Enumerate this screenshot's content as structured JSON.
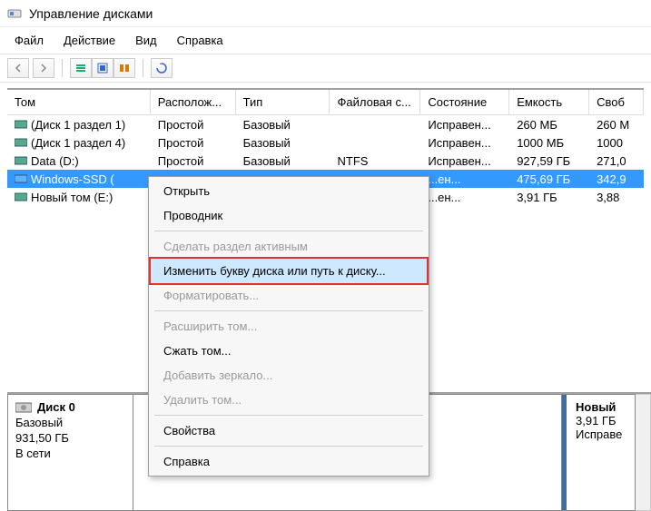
{
  "window": {
    "title": "Управление дисками"
  },
  "menu": {
    "file": "Файл",
    "action": "Действие",
    "view": "Вид",
    "help": "Справка"
  },
  "columns": {
    "volume": "Том",
    "layout": "Располож...",
    "type": "Тип",
    "fs": "Файловая с...",
    "status": "Состояние",
    "capacity": "Емкость",
    "free": "Своб"
  },
  "rows": [
    {
      "volume": "(Диск 1 раздел 1)",
      "layout": "Простой",
      "type": "Базовый",
      "fs": "",
      "status": "Исправен...",
      "capacity": "260 МБ",
      "free": "260 М",
      "selected": false
    },
    {
      "volume": "(Диск 1 раздел 4)",
      "layout": "Простой",
      "type": "Базовый",
      "fs": "",
      "status": "Исправен...",
      "capacity": "1000 МБ",
      "free": "1000",
      "selected": false
    },
    {
      "volume": "Data (D:)",
      "layout": "Простой",
      "type": "Базовый",
      "fs": "NTFS",
      "status": "Исправен...",
      "capacity": "927,59 ГБ",
      "free": "271,0",
      "selected": false
    },
    {
      "volume": "Windows-SSD (",
      "layout": "",
      "type": "",
      "fs": "",
      "status": "...ен...",
      "capacity": "475,69 ГБ",
      "free": "342,9",
      "selected": true
    },
    {
      "volume": "Новый том (E:)",
      "layout": "",
      "type": "",
      "fs": "",
      "status": "...ен...",
      "capacity": "3,91 ГБ",
      "free": "3,88",
      "selected": false
    }
  ],
  "context_menu": {
    "open": "Открыть",
    "explorer": "Проводник",
    "make_active": "Сделать раздел активным",
    "change_letter": "Изменить букву диска или путь к диску...",
    "format": "Форматировать...",
    "extend": "Расширить том...",
    "shrink": "Сжать том...",
    "add_mirror": "Добавить зеркало...",
    "delete": "Удалить том...",
    "properties": "Свойства",
    "help": "Справка"
  },
  "disk_panel": {
    "disk_name": "Диск 0",
    "disk_type": "Базовый",
    "disk_size": "931,50 ГБ",
    "disk_status": "В сети",
    "part_name": "Новый",
    "part_size": "3,91 ГБ",
    "part_health": "Исправе"
  }
}
